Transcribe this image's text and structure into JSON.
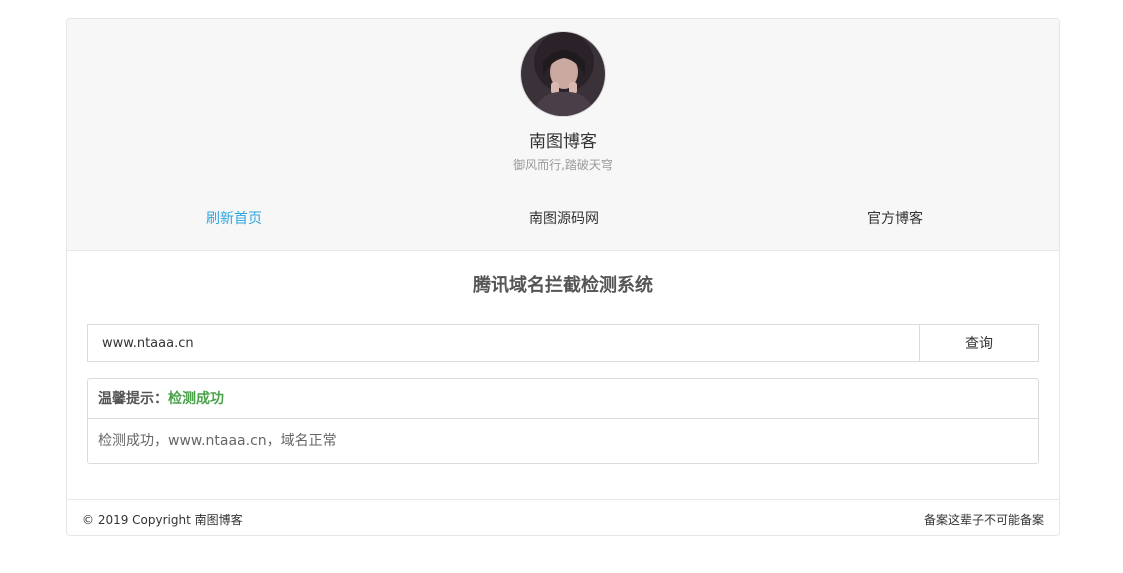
{
  "header": {
    "site_title": "南图博客",
    "subtitle": "御风而行,踏破天穹"
  },
  "nav": {
    "items": [
      {
        "label": "刷新首页",
        "active": true
      },
      {
        "label": "南图源码网",
        "active": false
      },
      {
        "label": "官方博客",
        "active": false
      }
    ]
  },
  "main": {
    "title": "腾讯域名拦截检测系统",
    "search": {
      "value": "www.ntaaa.cn",
      "button_label": "查询"
    },
    "result": {
      "prefix": "温馨提示：",
      "status": "检测成功",
      "message": "检测成功，www.ntaaa.cn，域名正常"
    }
  },
  "footer": {
    "copyright": "© 2019 Copyright 南图博客",
    "icp": "备案这辈子不可能备案"
  },
  "colors": {
    "accent": "#2fa6e0",
    "success": "#4aa34a",
    "header_bg": "#f7f7f7"
  }
}
